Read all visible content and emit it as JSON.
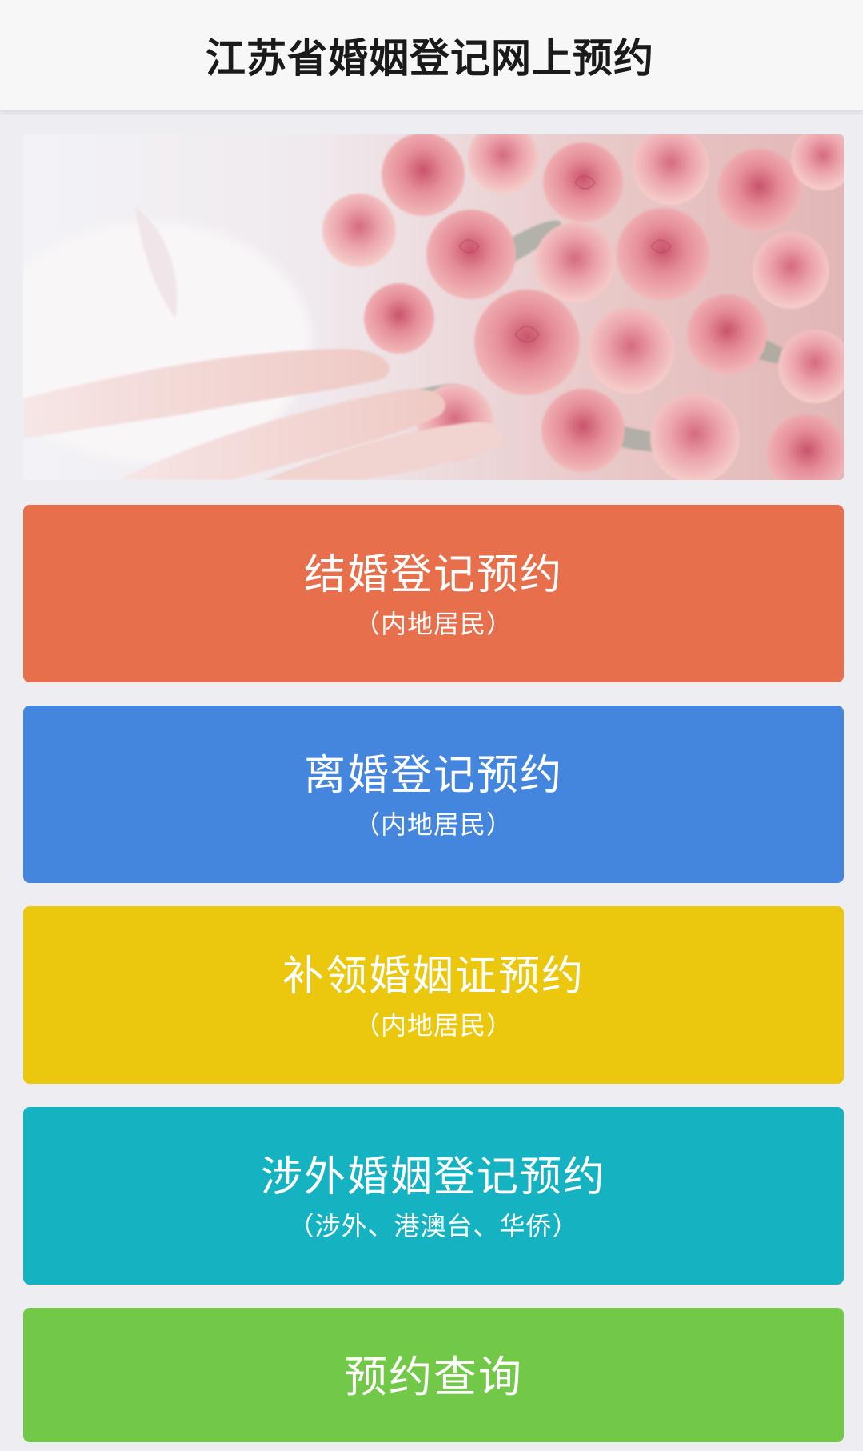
{
  "header": {
    "title": "江苏省婚姻登记网上预约"
  },
  "banner": {
    "image": "pink-roses-hand-photo"
  },
  "buttons": {
    "marriage": {
      "title": "结婚登记预约",
      "subtitle": "（内地居民）",
      "color": "#e76f4b"
    },
    "divorce": {
      "title": "离婚登记预约",
      "subtitle": "（内地居民）",
      "color": "#4486dd"
    },
    "reissue": {
      "title": "补领婚姻证预约",
      "subtitle": "（内地居民）",
      "color": "#ebc70e"
    },
    "foreign": {
      "title": "涉外婚姻登记预约",
      "subtitle": "（涉外、港澳台、华侨）",
      "color": "#15b2c2"
    },
    "query": {
      "title": "预约查询",
      "color": "#72c947"
    }
  }
}
